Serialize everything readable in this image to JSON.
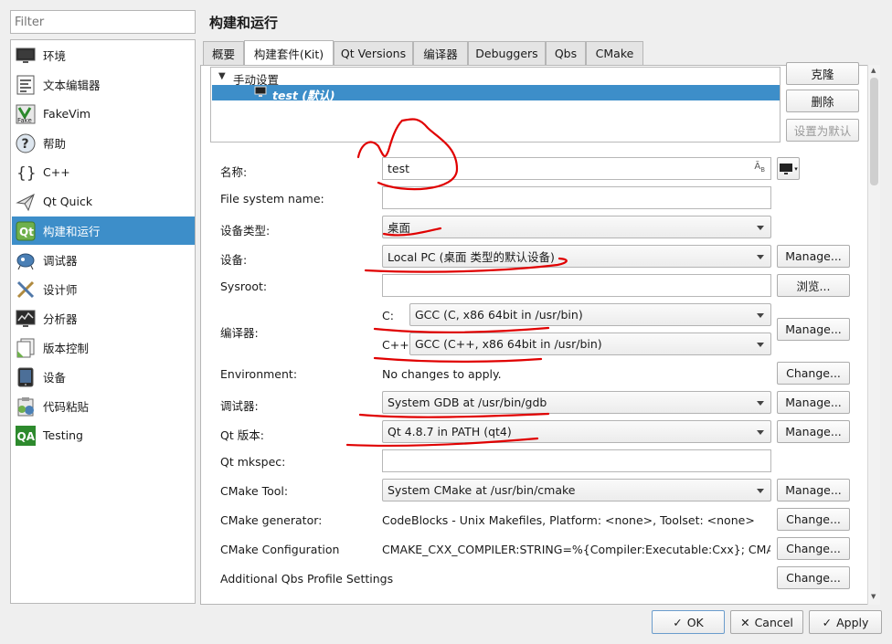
{
  "filter": {
    "placeholder": "Filter"
  },
  "nav": [
    {
      "label": "环境",
      "icon": "monitor-icon"
    },
    {
      "label": "文本编辑器",
      "icon": "text-editor-icon"
    },
    {
      "label": "FakeVim",
      "icon": "fakevim-icon"
    },
    {
      "label": "帮助",
      "icon": "help-icon"
    },
    {
      "label": "C++",
      "icon": "braces-icon"
    },
    {
      "label": "Qt Quick",
      "icon": "paper-plane-icon"
    },
    {
      "label": "构建和运行",
      "icon": "build-run-icon"
    },
    {
      "label": "调试器",
      "icon": "debugger-icon"
    },
    {
      "label": "设计师",
      "icon": "designer-icon"
    },
    {
      "label": "分析器",
      "icon": "analyzer-icon"
    },
    {
      "label": "版本控制",
      "icon": "version-control-icon"
    },
    {
      "label": "设备",
      "icon": "device-icon"
    },
    {
      "label": "代码粘贴",
      "icon": "code-paste-icon"
    },
    {
      "label": "Testing",
      "icon": "qa-icon"
    }
  ],
  "page_title": "构建和运行",
  "tabs": [
    "概要",
    "构建套件(Kit)",
    "Qt Versions",
    "编译器",
    "Debuggers",
    "Qbs",
    "CMake"
  ],
  "tree": {
    "group": "手动设置",
    "item": "test (默认)"
  },
  "side_buttons": {
    "clone": "克隆",
    "remove": "删除",
    "make_default": "设置为默认"
  },
  "form": {
    "name_label": "名称:",
    "name_value": "test",
    "fs_label": "File system name:",
    "device_type_label": "设备类型:",
    "device_type_value": "桌面",
    "device_label": "设备:",
    "device_value": "Local PC (桌面 类型的默认设备)",
    "sysroot_label": "Sysroot:",
    "browse": "浏览...",
    "compiler_label": "编译器:",
    "c_label": "C:",
    "c_value": "GCC (C, x86 64bit in /usr/bin)",
    "cpp_label": "C++:",
    "cpp_value": "GCC (C++, x86 64bit in /usr/bin)",
    "env_label": "Environment:",
    "env_value": "No changes to apply.",
    "debugger_label": "调试器:",
    "debugger_value": "System GDB at /usr/bin/gdb",
    "qt_label": "Qt 版本:",
    "qt_value": "Qt 4.8.7 in PATH (qt4)",
    "mkspec_label": "Qt mkspec:",
    "cmake_tool_label": "CMake Tool:",
    "cmake_tool_value": "System CMake at /usr/bin/cmake",
    "cmake_gen_label": "CMake generator:",
    "cmake_gen_value": "CodeBlocks - Unix Makefiles, Platform: <none>, Toolset: <none>",
    "cmake_conf_label": "CMake Configuration",
    "cmake_conf_value": "CMAKE_CXX_COMPILER:STRING=%{Compiler:Executable:Cxx}; CMAKE_C_…",
    "qbs_label": "Additional Qbs Profile Settings",
    "manage": "Manage...",
    "change": "Change..."
  },
  "footer": {
    "ok": "OK",
    "cancel": "Cancel",
    "apply": "Apply"
  },
  "colors": {
    "selection": "#3d8ec9",
    "annotation": "#e00000"
  }
}
